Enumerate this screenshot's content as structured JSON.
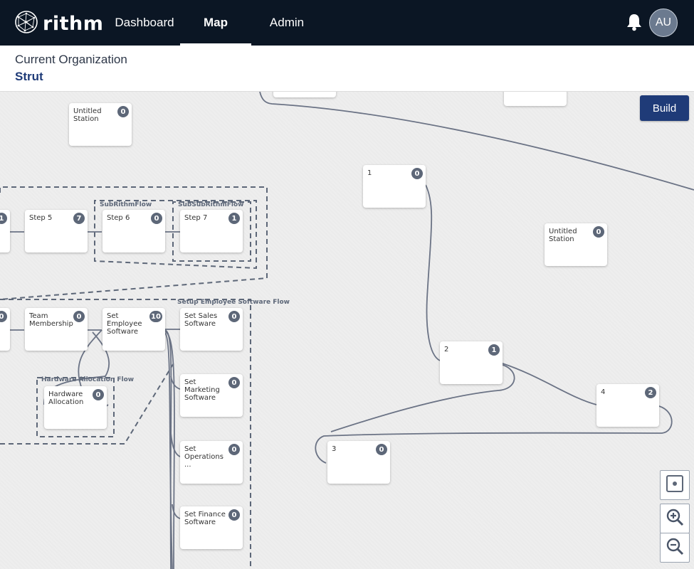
{
  "app": {
    "logo_text": "rithm"
  },
  "nav": {
    "items": [
      {
        "label": "Dashboard",
        "active": false
      },
      {
        "label": "Map",
        "active": true
      },
      {
        "label": "Admin",
        "active": false
      }
    ],
    "avatar_initials": "AU",
    "icons": [
      "rithm-logo-icon",
      "bell-icon"
    ]
  },
  "organization": {
    "label": "Current Organization",
    "name": "Strut"
  },
  "map": {
    "build_label": "Build",
    "flows": [
      {
        "name": "SubRithmFlow"
      },
      {
        "name": "SubSubRithmFlow"
      },
      {
        "name": "Setup Employee Software Flow"
      },
      {
        "name": "Hardware Allocation Flow"
      }
    ],
    "stations": [
      {
        "name": "Untitled Station",
        "count": "0"
      },
      {
        "name": "Step 5",
        "count": "7"
      },
      {
        "name": "Step 6",
        "count": "0"
      },
      {
        "name": "Step 7",
        "count": "1"
      },
      {
        "name": "Team Membership",
        "count": "0"
      },
      {
        "name": "Set Employee Software",
        "count": "10"
      },
      {
        "name": "Set Sales Software",
        "count": "0"
      },
      {
        "name": "Set Marketing Software",
        "count": "0"
      },
      {
        "name": "Set Operations ...",
        "count": "0"
      },
      {
        "name": "Set Finance Software",
        "count": "0"
      },
      {
        "name": "Hardware Allocation",
        "count": "0"
      },
      {
        "name": "1",
        "count": "0"
      },
      {
        "name": "Untitled Station",
        "count": "0"
      },
      {
        "name": "2",
        "count": "1"
      },
      {
        "name": "4",
        "count": "2"
      },
      {
        "name": "3",
        "count": "0"
      },
      {
        "name": "",
        "count": "1"
      },
      {
        "name": "",
        "count": "0"
      }
    ],
    "controls": [
      "center-icon",
      "zoom-in-icon",
      "zoom-out-icon"
    ],
    "colors": {
      "navbar": "#0b1624",
      "accent": "#1f3b78",
      "badge": "#5d6778",
      "wire": "#6b7385"
    }
  }
}
